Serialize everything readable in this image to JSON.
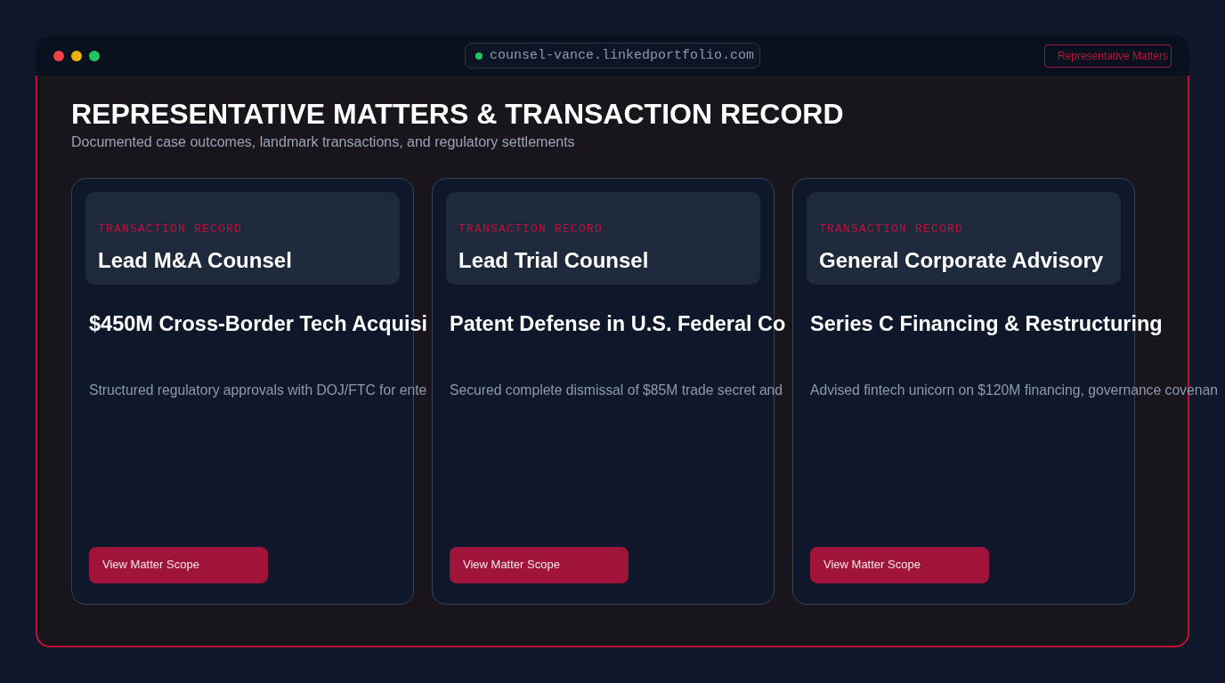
{
  "window": {
    "controls": [
      {
        "color": "#ef4444"
      },
      {
        "color": "#eab308"
      },
      {
        "color": "#22c55e"
      }
    ],
    "address": "counsel-vance.linkedportfolio.com",
    "nav_link": "Representative Matters"
  },
  "page": {
    "title": "REPRESENTATIVE MATTERS & TRANSACTION RECORD",
    "subtitle": "Documented case outcomes, landmark transactions, and regulatory settlements"
  },
  "cards": [
    {
      "label": "TRANSACTION RECORD",
      "role": "Lead M&A Counsel",
      "title": "$450M Cross-Border Tech Acquisi",
      "description": "Structured regulatory approvals with DOJ/FTC for ente",
      "button": "View Matter Scope"
    },
    {
      "label": "TRANSACTION RECORD",
      "role": "Lead Trial Counsel",
      "title": "Patent Defense in U.S. Federal Co",
      "description": "Secured complete dismissal of $85M trade secret and",
      "button": "View Matter Scope"
    },
    {
      "label": "TRANSACTION RECORD",
      "role": "General Corporate Advisory",
      "title": "Series C Financing & Restructuring",
      "description": "Advised fintech unicorn on $120M financing, governance covenan",
      "button": "View Matter Scope"
    }
  ]
}
